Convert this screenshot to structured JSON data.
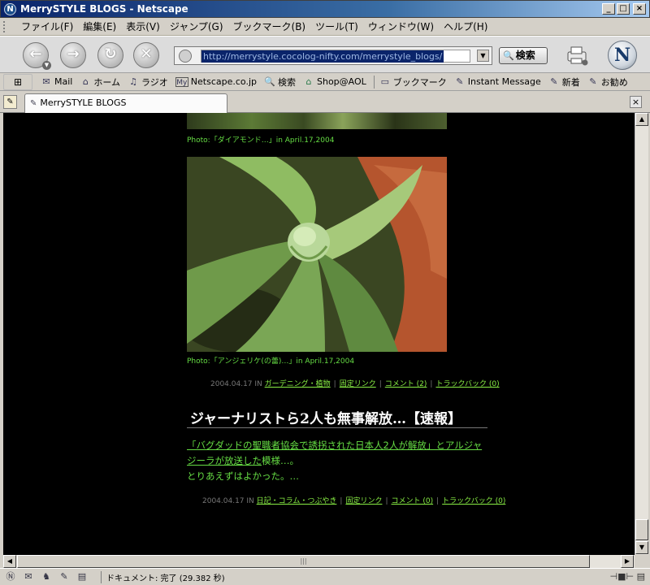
{
  "window": {
    "title": "MerrySTYLE BLOGS - Netscape",
    "app_icon": "N",
    "controls": [
      "_",
      "□",
      "×"
    ]
  },
  "menu": [
    "ファイル(F)",
    "編集(E)",
    "表示(V)",
    "ジャンプ(G)",
    "ブックマーク(B)",
    "ツール(T)",
    "ウィンドウ(W)",
    "ヘルプ(H)"
  ],
  "nav": {
    "back_icon": "←",
    "forward_icon": "→",
    "reload_icon": "↻",
    "stop_icon": "✕",
    "url": "http://merrystyle.cocolog-nifty.com/merrystyle_blogs/",
    "search_label": "検索",
    "logo": "N"
  },
  "personal_toolbar": {
    "items": [
      {
        "icon": "✉",
        "label": "Mail"
      },
      {
        "icon": "⌂",
        "label": "ホーム"
      },
      {
        "icon": "♫",
        "label": "ラジオ"
      },
      {
        "icon": "My",
        "label": "Netscape.co.jp"
      },
      {
        "icon": "🔍",
        "label": "検索"
      },
      {
        "icon": "⌂",
        "label": "Shop@AOL"
      },
      {
        "icon": "▭",
        "label": "ブックマーク"
      },
      {
        "icon": "✎",
        "label": "Instant Message"
      },
      {
        "icon": "✎",
        "label": "新着"
      },
      {
        "icon": "✎",
        "label": "お勧め"
      }
    ]
  },
  "tab": {
    "label": "MerrySTYLE BLOGS",
    "close": "×"
  },
  "content": {
    "caption1": "Photo:「ダイアモンド…」in April.17,2004",
    "caption2": "Photo:「アンジェリケ(の蕾)…」in April.17,2004",
    "entry1_meta": {
      "date": "2004.04.17 IN",
      "category": "ガーデニング・植物",
      "permalink": "固定リンク",
      "comments": "コメント (2)",
      "trackback": "トラックバック (0)"
    },
    "post_title": "ジャーナリストら2人も無事解放…【速報】",
    "post_body": {
      "link_text": "「バグダッドの聖職者協会で誘拐された日本人2人が解放」とアルジャジーラが放送した",
      "line_rest": "模様…。",
      "line2": "とりあえずはよかった。…"
    },
    "entry2_meta": {
      "date": "2004.04.17 IN",
      "category": "日記・コラム・つぶやき",
      "permalink": "固定リンク",
      "comments": "コメント (0)",
      "trackback": "トラックバック (0)"
    }
  },
  "status": {
    "text": "ドキュメント: 完了 (29.382 秒)"
  },
  "colors": {
    "page_bg": "#000000",
    "text_green": "#66dd44",
    "link_green": "#88ee44",
    "title_bar": "#0a246a"
  }
}
